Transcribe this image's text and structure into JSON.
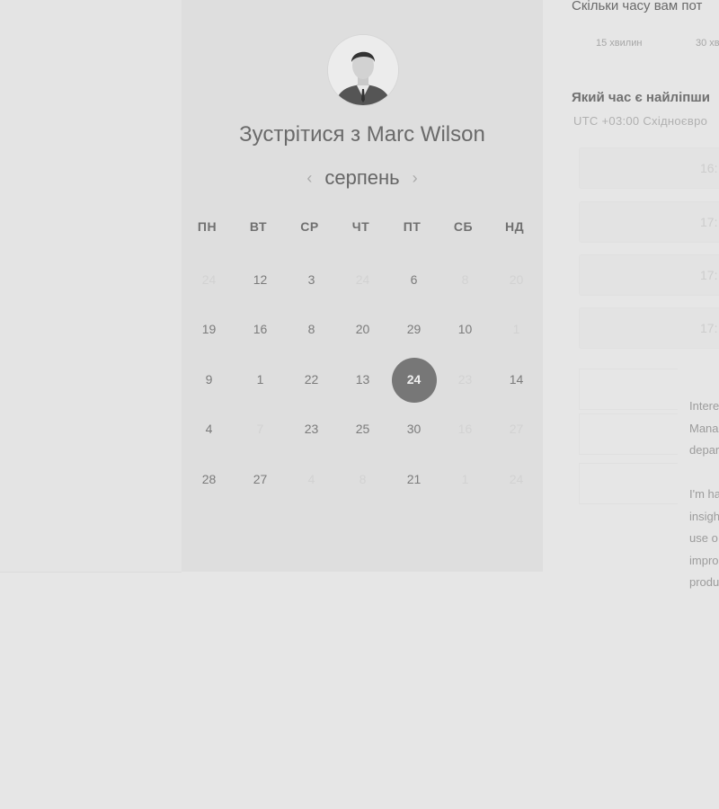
{
  "calendar": {
    "title": "Зустрітися з Marc Wilson",
    "month": "серпень",
    "prev_icon": "chevron-left-icon",
    "next_icon": "chevron-right-icon",
    "weekdays": [
      "ПН",
      "ВТ",
      "СР",
      "ЧТ",
      "ПТ",
      "СБ",
      "НД"
    ],
    "weeks": [
      [
        {
          "d": "24",
          "dim": true
        },
        {
          "d": "12",
          "dim": false
        },
        {
          "d": "3",
          "dim": false
        },
        {
          "d": "24",
          "dim": true
        },
        {
          "d": "6",
          "dim": false
        },
        {
          "d": "8",
          "dim": true
        },
        {
          "d": "20",
          "dim": true
        }
      ],
      [
        {
          "d": "19",
          "dim": false
        },
        {
          "d": "16",
          "dim": false
        },
        {
          "d": "8",
          "dim": false
        },
        {
          "d": "20",
          "dim": false
        },
        {
          "d": "29",
          "dim": false
        },
        {
          "d": "10",
          "dim": false
        },
        {
          "d": "1",
          "dim": true
        }
      ],
      [
        {
          "d": "9",
          "dim": false
        },
        {
          "d": "1",
          "dim": false
        },
        {
          "d": "22",
          "dim": false
        },
        {
          "d": "13",
          "dim": false
        },
        {
          "d": "24",
          "dim": false,
          "selected": true
        },
        {
          "d": "23",
          "dim": true
        },
        {
          "d": "14",
          "dim": false
        }
      ],
      [
        {
          "d": "4",
          "dim": false
        },
        {
          "d": "7",
          "dim": true
        },
        {
          "d": "23",
          "dim": false
        },
        {
          "d": "25",
          "dim": false
        },
        {
          "d": "30",
          "dim": false
        },
        {
          "d": "16",
          "dim": true
        },
        {
          "d": "27",
          "dim": true
        }
      ],
      [
        {
          "d": "28",
          "dim": false
        },
        {
          "d": "27",
          "dim": false
        },
        {
          "d": "4",
          "dim": true
        },
        {
          "d": "8",
          "dim": true
        },
        {
          "d": "21",
          "dim": false
        },
        {
          "d": "1",
          "dim": true
        },
        {
          "d": "24",
          "dim": true
        }
      ]
    ],
    "selected_color": "#777777"
  },
  "booking": {
    "duration_question": "Скільки часу вам пот",
    "durations": [
      "15 хвилин",
      "30 хв"
    ],
    "time_question": "Який час є найліпши",
    "timezone": "UTC +03:00 Східноєвро",
    "slots": [
      "16:",
      "17:",
      "17:",
      "17:"
    ]
  },
  "bio": {
    "paragraph1": [
      "Intere",
      "Mana",
      "depar"
    ],
    "paragraph2": [
      "I'm ha",
      "insigh",
      "use o",
      "impro",
      "produ"
    ]
  }
}
